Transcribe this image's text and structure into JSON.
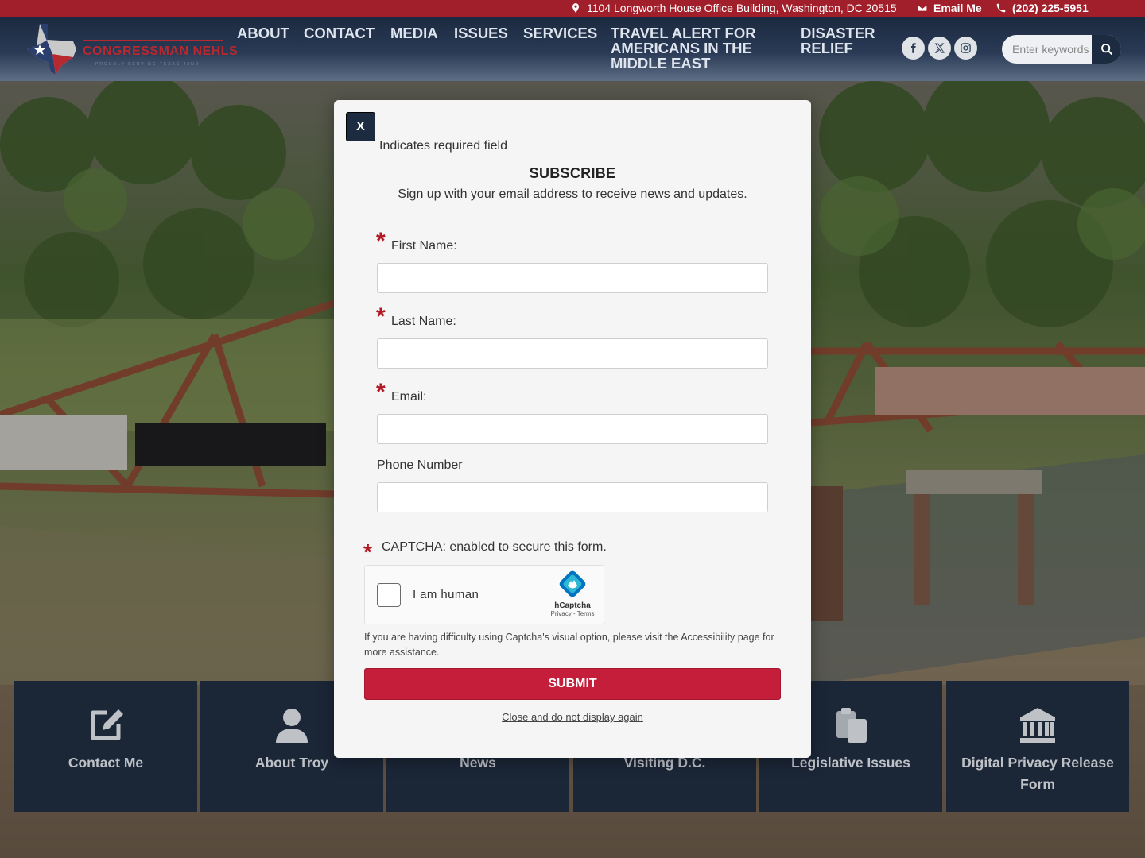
{
  "topbar": {
    "address": "1104 Longworth House Office Building, Washington, DC 20515",
    "email": "Email Me",
    "phone": "(202) 225-5951"
  },
  "header": {
    "logo_text": "CONGRESSMAN NEHLS",
    "logo_tagline": "PROUDLY SERVING TEXAS 22ND",
    "nav": [
      {
        "label": "ABOUT"
      },
      {
        "label": "CONTACT"
      },
      {
        "label": "MEDIA"
      },
      {
        "label": "ISSUES"
      },
      {
        "label": "SERVICES"
      },
      {
        "label": "TRAVEL ALERT FOR AMERICANS IN THE MIDDLE EAST"
      },
      {
        "label": "DISASTER RELIEF"
      }
    ],
    "social": [
      {
        "icon": "facebook-icon"
      },
      {
        "icon": "x-twitter-icon"
      },
      {
        "icon": "instagram-icon"
      }
    ],
    "search": {
      "placeholder": "Enter keywords"
    }
  },
  "tiles": [
    {
      "label": "Contact Me",
      "icon": "edit-icon"
    },
    {
      "label": "About Troy",
      "icon": "user-icon"
    },
    {
      "label": "News",
      "icon": "newspaper-icon"
    },
    {
      "label": "Visiting D.C.",
      "icon": "capitol-icon"
    },
    {
      "label": "Legislative Issues",
      "icon": "clipboard-icon"
    },
    {
      "label": "Digital Privacy Release Form",
      "icon": "institution-icon"
    }
  ],
  "modal": {
    "close_label": "X",
    "required_note": "Indicates required field",
    "title": "SUBSCRIBE",
    "subtitle": "Sign up with your email address to receive news and updates.",
    "fields": [
      {
        "label": "First Name:",
        "value": "",
        "required": true
      },
      {
        "label": "Last Name:",
        "value": "",
        "required": true
      },
      {
        "label": "Email:",
        "value": "",
        "required": true
      },
      {
        "label": "Phone Number",
        "value": "",
        "required": false
      }
    ],
    "captcha_label": "CAPTCHA: enabled to secure this form.",
    "captcha_checkbox": "I am human",
    "captcha_brand": "hCaptcha",
    "captcha_links": "Privacy - Terms",
    "help_text": "If you are having difficulty using Captcha's visual option, please visit the Accessibility page for more assistance.",
    "submit_label": "SUBMIT",
    "no_display_label": "Close and do not display again"
  },
  "colors": {
    "topbar": "#a11f2a",
    "header": "#1c2a40",
    "submit": "#c41e3a",
    "required_star": "#b31824",
    "tile": "#1e2d44"
  }
}
